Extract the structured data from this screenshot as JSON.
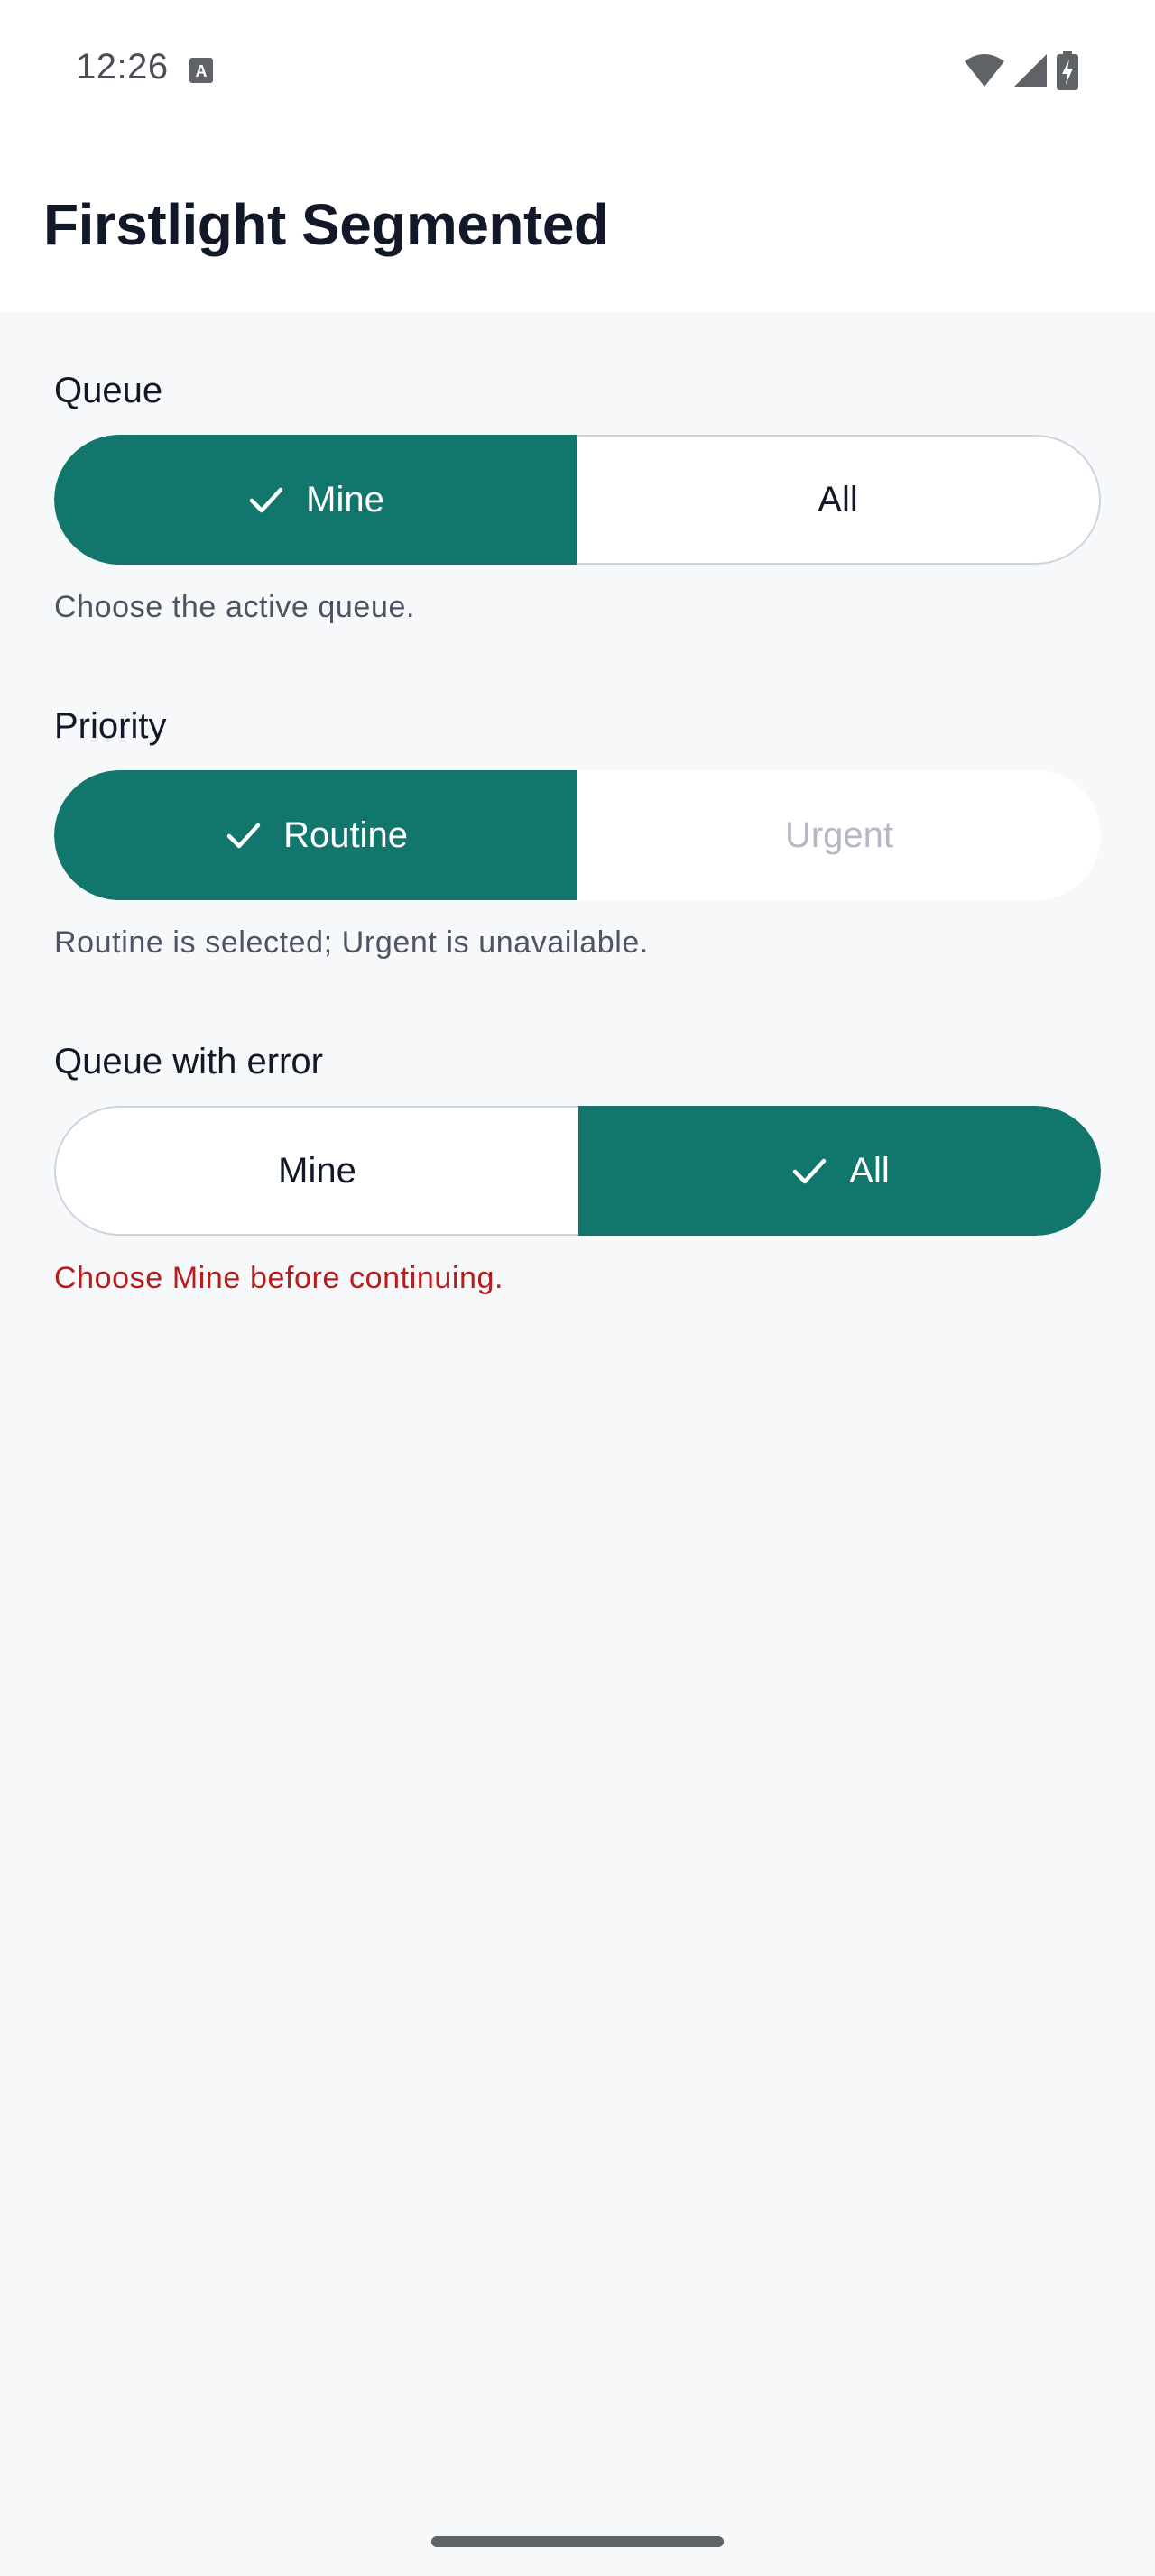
{
  "status_bar": {
    "time": "12:26",
    "icons": [
      "text-a-notification-icon",
      "wifi-icon",
      "cellular-signal-icon",
      "battery-charging-icon"
    ]
  },
  "app": {
    "title": "Firstlight Segmented"
  },
  "colors": {
    "accent": "#11766c",
    "error": "#b91c1c",
    "background": "#f7f8fa",
    "border": "#cbd3dd",
    "disabled_text": "#b3b8c2"
  },
  "sections": [
    {
      "label": "Queue",
      "options": [
        {
          "label": "Mine",
          "selected": true,
          "enabled": true
        },
        {
          "label": "All",
          "selected": false,
          "enabled": true
        }
      ],
      "helper": "Choose the active queue.",
      "helper_is_error": false
    },
    {
      "label": "Priority",
      "options": [
        {
          "label": "Routine",
          "selected": true,
          "enabled": true
        },
        {
          "label": "Urgent",
          "selected": false,
          "enabled": false
        }
      ],
      "helper": "Routine is selected; Urgent is unavailable.",
      "helper_is_error": false
    },
    {
      "label": "Queue with error",
      "options": [
        {
          "label": "Mine",
          "selected": false,
          "enabled": true
        },
        {
          "label": "All",
          "selected": true,
          "enabled": true
        }
      ],
      "helper": "Choose Mine before continuing.",
      "helper_is_error": true
    }
  ]
}
